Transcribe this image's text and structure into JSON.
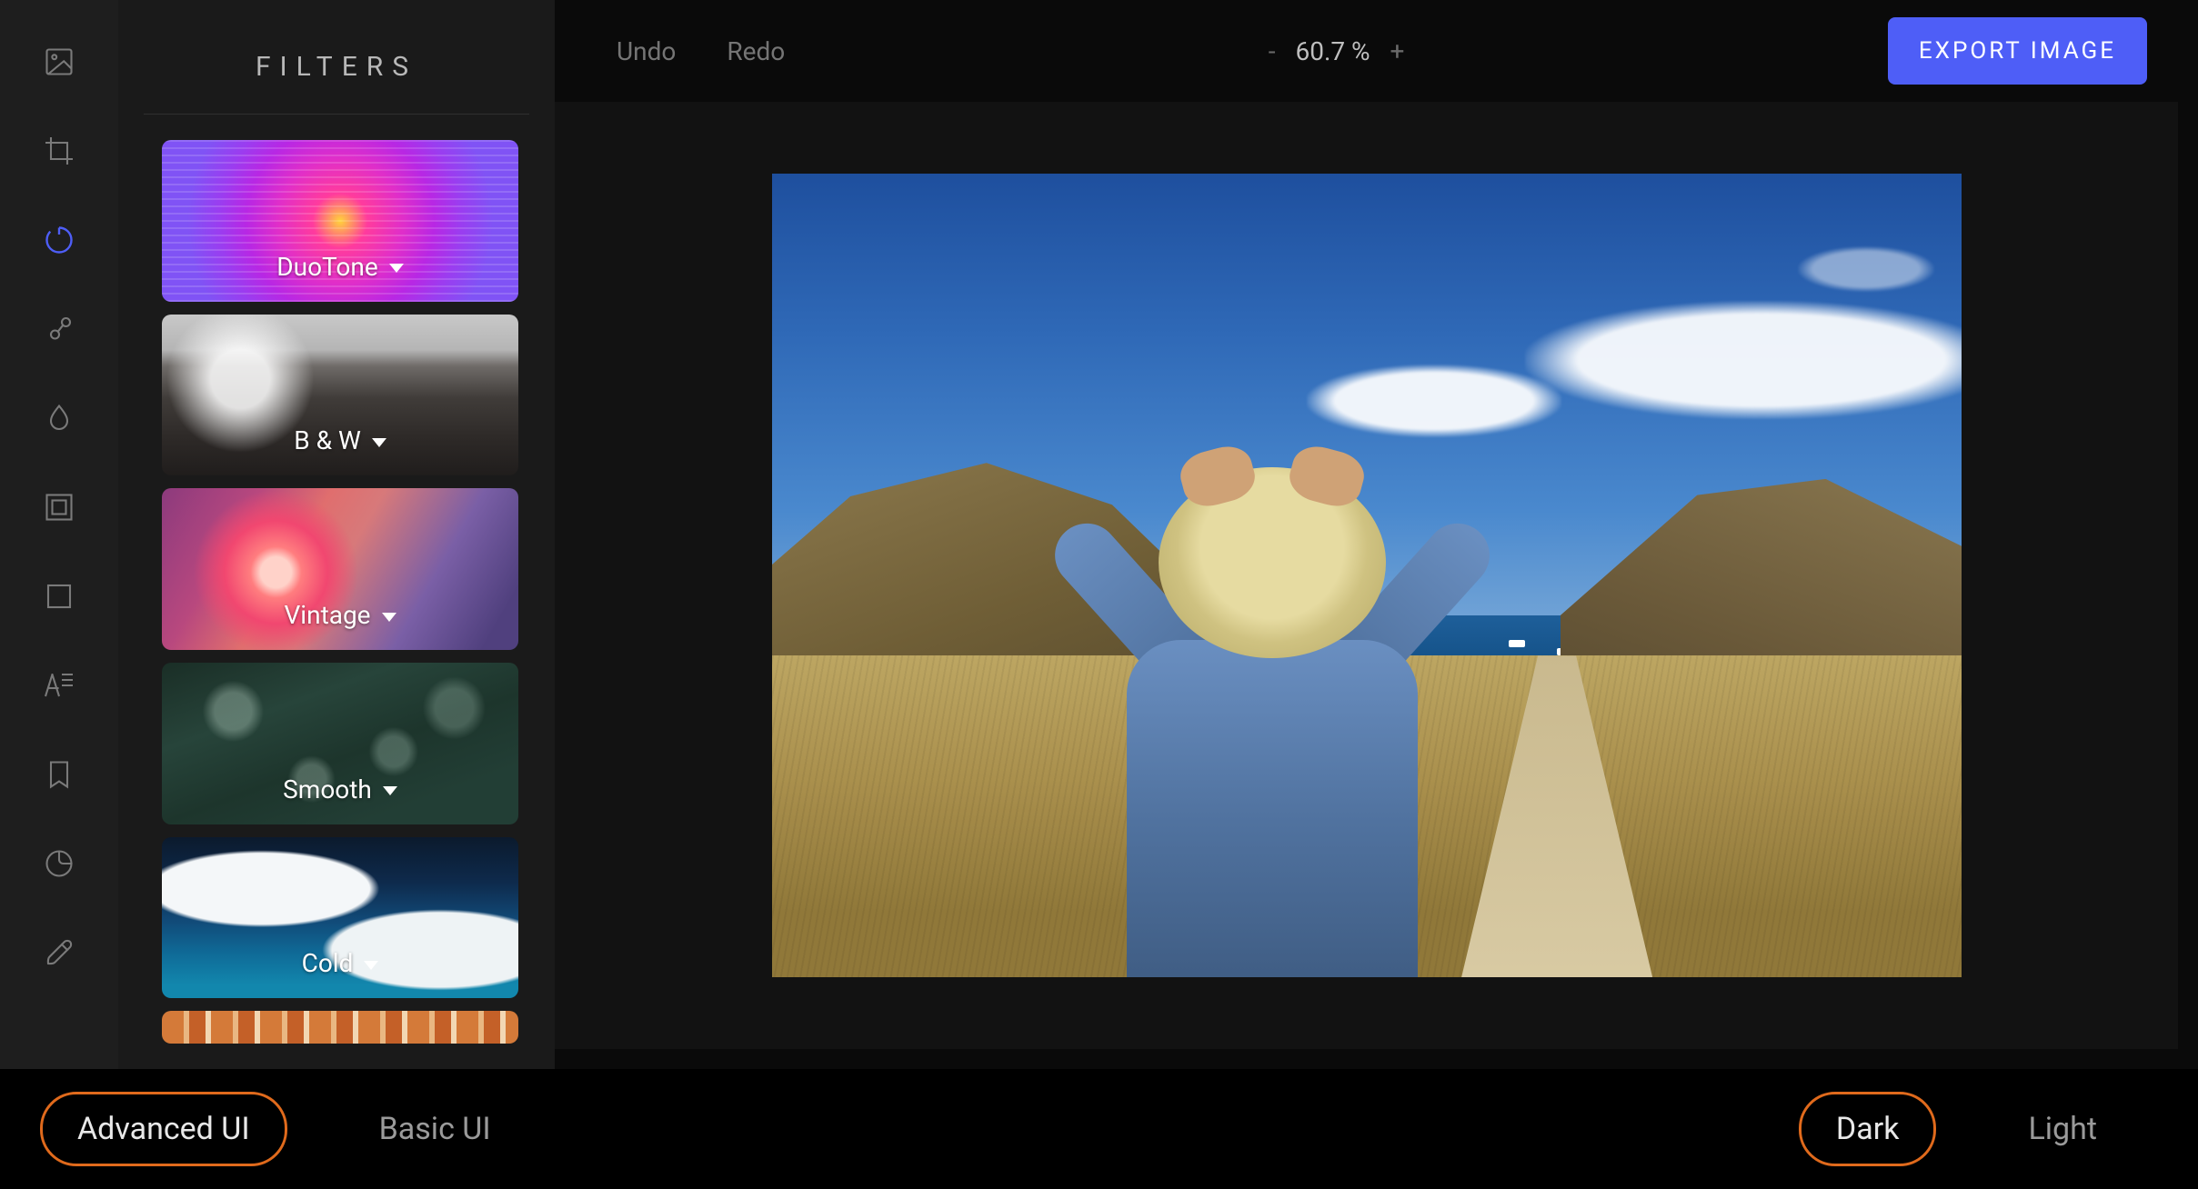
{
  "panel": {
    "title": "FILTERS"
  },
  "filters": {
    "duotone": "DuoTone",
    "bw": "B & W",
    "vintage": "Vintage",
    "smooth": "Smooth",
    "cold": "Cold"
  },
  "topbar": {
    "undo": "Undo",
    "redo": "Redo",
    "zoom_minus": "-",
    "zoom_value": "60.7 %",
    "zoom_plus": "+",
    "export": "EXPORT IMAGE"
  },
  "bottom": {
    "advanced": "Advanced UI",
    "basic": "Basic UI",
    "dark": "Dark",
    "light": "Light"
  },
  "rail": {
    "library": "library-icon",
    "crop": "crop-icon",
    "adjust": "adjust-icon",
    "focus": "focus-icon",
    "filter": "filter-drop-icon",
    "frame": "frame-icon",
    "overlay": "overlay-icon",
    "text": "text-icon",
    "bookmark": "bookmark-icon",
    "sticker": "sticker-icon",
    "brush": "brush-icon"
  }
}
